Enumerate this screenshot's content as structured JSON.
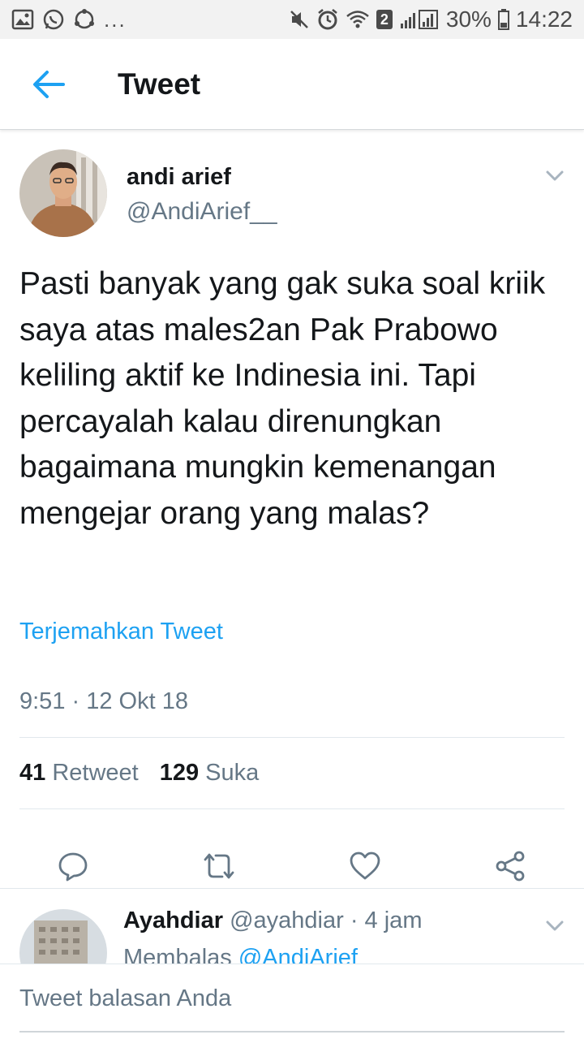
{
  "status_bar": {
    "more": "...",
    "sim_badge": "2",
    "battery": "30%",
    "time": "14:22"
  },
  "app_bar": {
    "title": "Tweet"
  },
  "tweet": {
    "author_name": "andi arief",
    "author_handle": "@AndiArief__",
    "text": "Pasti banyak yang gak suka soal kriik saya atas males2an Pak Prabowo keliling aktif ke Indinesia ini. Tapi percayalah kalau direnungkan bagaimana mungkin kemenangan mengejar orang yang malas?",
    "translate_label": "Terjemahkan Tweet",
    "timestamp": "9:51 · 12 Okt 18",
    "retweet_count": "41",
    "retweet_label": "Retweet",
    "like_count": "129",
    "like_label": "Suka"
  },
  "reply": {
    "name": "Ayahdiar",
    "handle": "@ayahdiar",
    "time": "· 4 jam",
    "replying_label": "Membalas",
    "replying_mention": "@AndiArief__"
  },
  "compose": {
    "placeholder": "Tweet balasan Anda"
  },
  "colors": {
    "accent": "#1da1f2",
    "secondary_text": "#657786",
    "primary_text": "#14171a"
  }
}
